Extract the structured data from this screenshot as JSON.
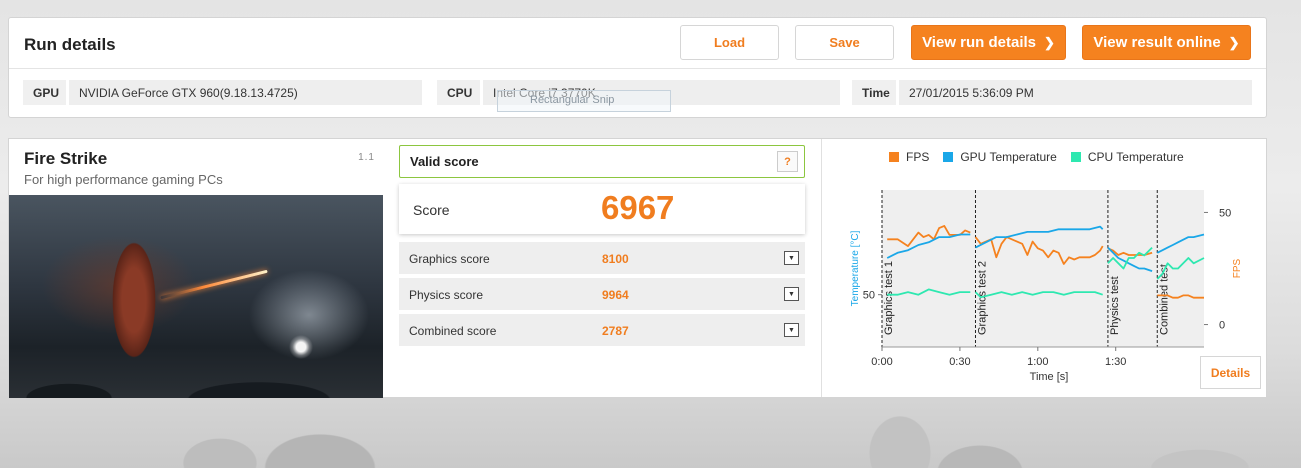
{
  "run_details": {
    "title": "Run details",
    "buttons": {
      "load": "Load",
      "save": "Save",
      "view_run_details": "View run details",
      "view_result_online": "View result online"
    },
    "info": {
      "gpu_label": "GPU",
      "gpu_value": "NVIDIA GeForce GTX 960(9.18.13.4725)",
      "cpu_label": "CPU",
      "cpu_value": "Intel Core i7 3770K",
      "time_label": "Time",
      "time_value": "27/01/2015 5:36:09 PM"
    },
    "snip_overlay": "Rectangular Snip"
  },
  "benchmark": {
    "title": "Fire Strike",
    "version": "1.1",
    "subtitle": "For high performance gaming PCs"
  },
  "result": {
    "status": "Valid score",
    "help": "?",
    "score_label": "Score",
    "score_value": "6967",
    "subscores": [
      {
        "label": "Graphics score",
        "value": "8100"
      },
      {
        "label": "Physics score",
        "value": "9964"
      },
      {
        "label": "Combined score",
        "value": "2787"
      }
    ]
  },
  "details_button": "Details",
  "colors": {
    "accent": "#f5821f",
    "valid": "#8cc63f",
    "fps": "#f5821f",
    "gpu_temp": "#1aa7e8",
    "cpu_temp": "#2ee8b0"
  },
  "chart_data": {
    "type": "line",
    "legend": [
      "FPS",
      "GPU Temperature",
      "CPU Temperature"
    ],
    "xlabel": "Time [s]",
    "ylabel_left": "Temperature [°C]",
    "ylabel_right": "FPS",
    "x_ticks": [
      "0:00",
      "0:30",
      "1:00",
      "1:30"
    ],
    "y_left_ticks": [
      "50"
    ],
    "y_right_ticks": [
      "50",
      "0"
    ],
    "sections": [
      {
        "label": "Graphics test 1",
        "start": 0,
        "end": 34
      },
      {
        "label": "Graphics test 2",
        "start": 36,
        "end": 85
      },
      {
        "label": "Physics test",
        "start": 87,
        "end": 104
      },
      {
        "label": "Combined test",
        "start": 106,
        "end": 124
      }
    ],
    "y_left_range": [
      40,
      70
    ],
    "y_right_range": [
      -10,
      60
    ],
    "series": [
      {
        "name": "FPS",
        "axis": "right",
        "segments": [
          {
            "x": [
              2,
              6,
              10,
              12,
              14,
              16,
              18,
              20,
              22,
              24,
              26,
              28,
              30,
              32,
              34
            ],
            "y": [
              38,
              38,
              35,
              38,
              41,
              39,
              40,
              38,
              43,
              44,
              40,
              40,
              40,
              42,
              41
            ]
          },
          {
            "x": [
              36,
              38,
              42,
              44,
              46,
              48,
              50,
              52,
              54,
              56,
              58,
              60,
              62,
              64,
              66,
              68,
              70,
              72,
              74,
              76,
              78,
              80,
              82,
              84,
              85
            ],
            "y": [
              39,
              36,
              38,
              30,
              36,
              39,
              38,
              37,
              36,
              31,
              37,
              34,
              33,
              30,
              33,
              32,
              27,
              30,
              29,
              30,
              30,
              30,
              31,
              33,
              35
            ]
          },
          {
            "x": [
              87,
              89,
              91,
              93,
              95,
              97,
              99,
              101,
              104
            ],
            "y": [
              34,
              33,
              31,
              32,
              31,
              31,
              31,
              31,
              32
            ]
          },
          {
            "x": [
              106,
              108,
              110,
              112,
              114,
              116,
              118,
              120,
              124
            ],
            "y": [
              13,
              13,
              13,
              12,
              12,
              13,
              13,
              12,
              12
            ]
          }
        ]
      },
      {
        "name": "GPU Temperature",
        "axis": "left",
        "segments": [
          {
            "x": [
              2,
              6,
              10,
              14,
              18,
              22,
              26,
              30,
              34
            ],
            "y": [
              57,
              58,
              58.5,
              59.5,
              60,
              61,
              61,
              61.5,
              61.5
            ]
          },
          {
            "x": [
              36,
              40,
              44,
              48,
              52,
              56,
              60,
              64,
              68,
              72,
              76,
              80,
              84,
              85
            ],
            "y": [
              59,
              60,
              61,
              61,
              61.5,
              62,
              62,
              62,
              62.5,
              62.5,
              62.5,
              62.5,
              63,
              62.5
            ]
          },
          {
            "x": [
              87,
              89,
              91,
              93,
              95,
              97,
              99,
              101,
              104
            ],
            "y": [
              59,
              58,
              57,
              56.5,
              56,
              55.5,
              55,
              55,
              54.5
            ]
          },
          {
            "x": [
              106,
              108,
              110,
              112,
              114,
              116,
              118,
              120,
              124
            ],
            "y": [
              58,
              58.5,
              59,
              59.5,
              60,
              60.5,
              61,
              61,
              61.5
            ]
          }
        ]
      },
      {
        "name": "CPU Temperature",
        "axis": "left",
        "segments": [
          {
            "x": [
              2,
              6,
              10,
              14,
              18,
              22,
              26,
              30,
              34
            ],
            "y": [
              50,
              50,
              50.5,
              50,
              51,
              50.5,
              50,
              50.5,
              50.5
            ]
          },
          {
            "x": [
              36,
              38,
              42,
              46,
              50,
              54,
              58,
              62,
              66,
              70,
              74,
              78,
              82,
              85
            ],
            "y": [
              50.5,
              49.5,
              50,
              50.5,
              50,
              50.5,
              50,
              50.5,
              50.5,
              50,
              50.5,
              50.5,
              50.5,
              50
            ]
          },
          {
            "x": [
              87,
              89,
              91,
              93,
              95,
              97,
              99,
              101,
              104
            ],
            "y": [
              56,
              57,
              56,
              55,
              57,
              57,
              58,
              57.5,
              59
            ]
          },
          {
            "x": [
              106,
              108,
              110,
              112,
              114,
              116,
              118,
              120,
              124
            ],
            "y": [
              53,
              54,
              56,
              55,
              55,
              56,
              57,
              56,
              57
            ]
          }
        ]
      }
    ]
  }
}
